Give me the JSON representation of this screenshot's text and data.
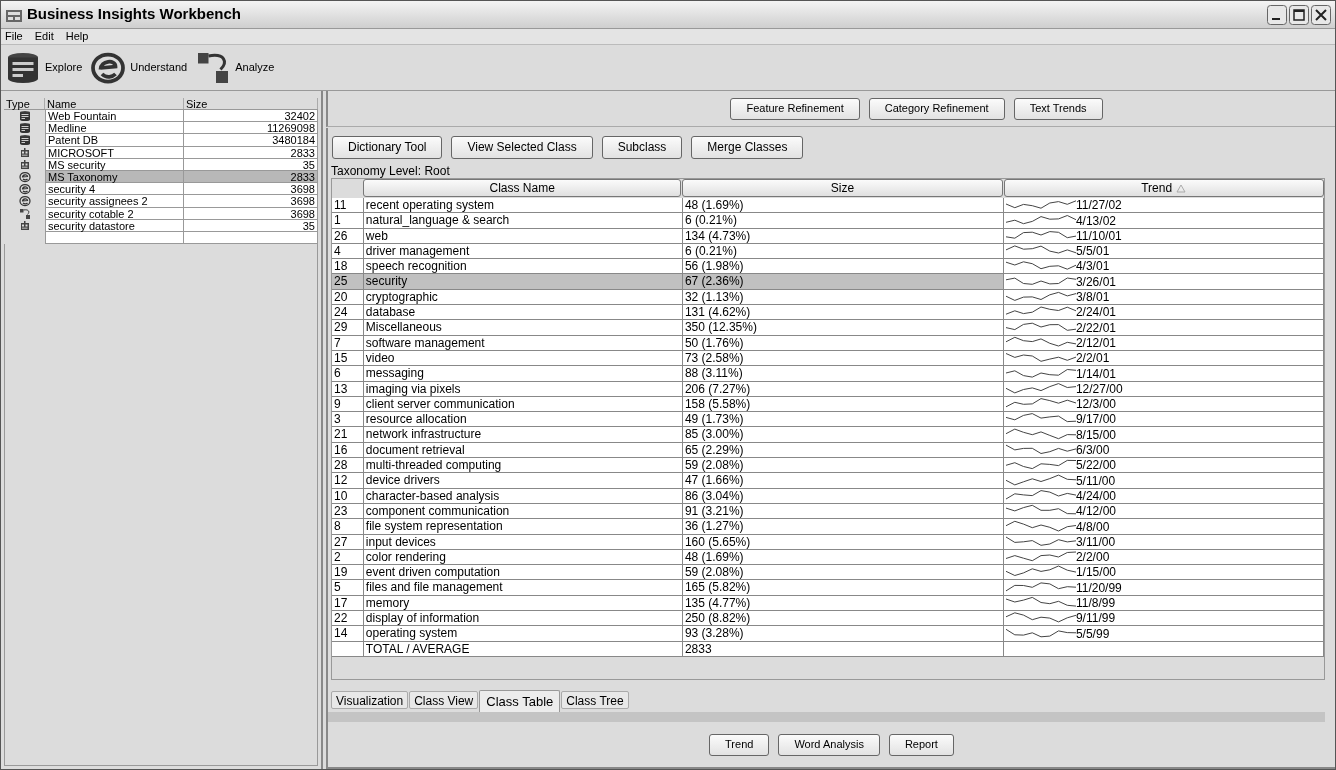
{
  "window": {
    "title": "Business Insights Workbench"
  },
  "menu": [
    "File",
    "Edit",
    "Help"
  ],
  "toolbar": [
    {
      "kind": "database",
      "label": "Explore"
    },
    {
      "kind": "taxonomy",
      "label": "Understand"
    },
    {
      "kind": "cubes",
      "label": "Analyze"
    }
  ],
  "sources": {
    "columns": [
      "Type",
      "Name",
      "Size"
    ],
    "rows": [
      {
        "kind": "database",
        "name": "Web Fountain",
        "size": "32402",
        "selected": false
      },
      {
        "kind": "database",
        "name": "Medline",
        "size": "11269098",
        "selected": false
      },
      {
        "kind": "database",
        "name": "Patent DB",
        "size": "3480184",
        "selected": false
      },
      {
        "kind": "datastore",
        "name": "MICROSOFT",
        "size": "2833",
        "selected": false
      },
      {
        "kind": "datastore",
        "name": "MS security",
        "size": "35",
        "selected": false
      },
      {
        "kind": "taxonomy",
        "name": "MS Taxonomy",
        "size": "2833",
        "selected": true
      },
      {
        "kind": "taxonomy",
        "name": "security 4",
        "size": "3698",
        "selected": false
      },
      {
        "kind": "taxonomy",
        "name": "security assignees 2",
        "size": "3698",
        "selected": false
      },
      {
        "kind": "cubes",
        "name": "security cotable 2",
        "size": "3698",
        "selected": false
      },
      {
        "kind": "datastore",
        "name": "security datastore",
        "size": "35",
        "selected": false
      }
    ]
  },
  "top_buttons": [
    "Feature Refinement",
    "Category Refinement",
    "Text Trends"
  ],
  "class_buttons": [
    "Dictionary Tool",
    "View Selected Class",
    "Subclass",
    "Merge Classes"
  ],
  "taxonomy_level": "Taxonomy Level: Root",
  "table": {
    "columns": [
      "Class Name",
      "Size",
      "Trend"
    ],
    "rows": [
      {
        "id": "11",
        "name": "recent operating system",
        "size": "48 (1.69%)",
        "date": "11/27/02",
        "selected": false
      },
      {
        "id": "1",
        "name": "natural_language & search",
        "size": "6 (0.21%)",
        "date": "4/13/02",
        "selected": false
      },
      {
        "id": "26",
        "name": "web",
        "size": "134 (4.73%)",
        "date": "11/10/01",
        "selected": false
      },
      {
        "id": "4",
        "name": "driver management",
        "size": "6 (0.21%)",
        "date": "5/5/01",
        "selected": false
      },
      {
        "id": "18",
        "name": "speech recognition",
        "size": "56 (1.98%)",
        "date": "4/3/01",
        "selected": false
      },
      {
        "id": "25",
        "name": "security",
        "size": "67 (2.36%)",
        "date": "3/26/01",
        "selected": true
      },
      {
        "id": "20",
        "name": "cryptographic",
        "size": "32 (1.13%)",
        "date": "3/8/01",
        "selected": false
      },
      {
        "id": "24",
        "name": "database",
        "size": "131 (4.62%)",
        "date": "2/24/01",
        "selected": false
      },
      {
        "id": "29",
        "name": "Miscellaneous",
        "size": "350 (12.35%)",
        "date": "2/22/01",
        "selected": false
      },
      {
        "id": "7",
        "name": "software management",
        "size": "50 (1.76%)",
        "date": "2/12/01",
        "selected": false
      },
      {
        "id": "15",
        "name": "video",
        "size": "73 (2.58%)",
        "date": "2/2/01",
        "selected": false
      },
      {
        "id": "6",
        "name": "messaging",
        "size": "88 (3.11%)",
        "date": "1/14/01",
        "selected": false
      },
      {
        "id": "13",
        "name": "imaging via pixels",
        "size": "206 (7.27%)",
        "date": "12/27/00",
        "selected": false
      },
      {
        "id": "9",
        "name": "client server communication",
        "size": "158 (5.58%)",
        "date": "12/3/00",
        "selected": false
      },
      {
        "id": "3",
        "name": "resource allocation",
        "size": "49 (1.73%)",
        "date": "9/17/00",
        "selected": false
      },
      {
        "id": "21",
        "name": "network infrastructure",
        "size": "85 (3.00%)",
        "date": "8/15/00",
        "selected": false
      },
      {
        "id": "16",
        "name": "document retrieval",
        "size": "65 (2.29%)",
        "date": "6/3/00",
        "selected": false
      },
      {
        "id": "28",
        "name": "multi-threaded computing",
        "size": "59 (2.08%)",
        "date": "5/22/00",
        "selected": false
      },
      {
        "id": "12",
        "name": "device drivers",
        "size": "47 (1.66%)",
        "date": "5/11/00",
        "selected": false
      },
      {
        "id": "10",
        "name": "character-based analysis",
        "size": "86 (3.04%)",
        "date": "4/24/00",
        "selected": false
      },
      {
        "id": "23",
        "name": "component communication",
        "size": "91 (3.21%)",
        "date": "4/12/00",
        "selected": false
      },
      {
        "id": "8",
        "name": "file system representation",
        "size": "36 (1.27%)",
        "date": "4/8/00",
        "selected": false
      },
      {
        "id": "27",
        "name": "input devices",
        "size": "160 (5.65%)",
        "date": "3/11/00",
        "selected": false
      },
      {
        "id": "2",
        "name": "color rendering",
        "size": "48 (1.69%)",
        "date": "2/2/00",
        "selected": false
      },
      {
        "id": "19",
        "name": "event driven computation",
        "size": "59 (2.08%)",
        "date": "1/15/00",
        "selected": false
      },
      {
        "id": "5",
        "name": "files and file management",
        "size": "165 (5.82%)",
        "date": "11/20/99",
        "selected": false
      },
      {
        "id": "17",
        "name": "memory",
        "size": "135 (4.77%)",
        "date": "11/8/99",
        "selected": false
      },
      {
        "id": "22",
        "name": "display of information",
        "size": "250 (8.82%)",
        "date": "9/11/99",
        "selected": false
      },
      {
        "id": "14",
        "name": "operating system",
        "size": "93 (3.28%)",
        "date": "5/5/99",
        "selected": false
      }
    ],
    "total": {
      "name": "TOTAL / AVERAGE",
      "size": "2833"
    }
  },
  "tabs": [
    {
      "label": "Visualization",
      "selected": false
    },
    {
      "label": "Class View",
      "selected": false
    },
    {
      "label": "Class Table",
      "selected": true
    },
    {
      "label": "Class Tree",
      "selected": false
    }
  ],
  "bottom_buttons": [
    "Trend",
    "Word Analysis",
    "Report"
  ]
}
